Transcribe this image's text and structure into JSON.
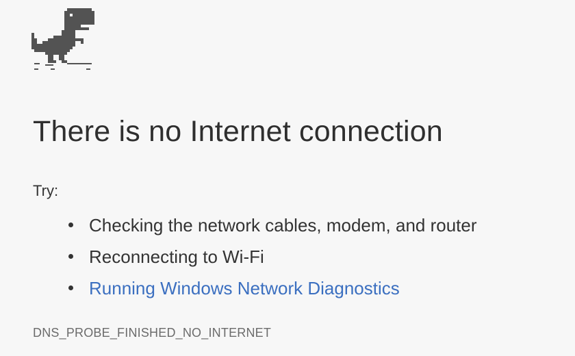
{
  "error_page": {
    "icon": "offline-dino-icon",
    "title": "There is no Internet connection",
    "try_label": "Try:",
    "suggestions": [
      {
        "text": "Checking the network cables, modem, and router",
        "link": false
      },
      {
        "text": "Reconnecting to Wi-Fi",
        "link": false
      },
      {
        "text": "Running Windows Network Diagnostics",
        "link": true
      }
    ],
    "error_code": "DNS_PROBE_FINISHED_NO_INTERNET"
  },
  "colors": {
    "background": "#f7f7f7",
    "text": "#333333",
    "link": "#3b6fc0",
    "error_code": "#6b6b6b",
    "dino": "#535353"
  }
}
